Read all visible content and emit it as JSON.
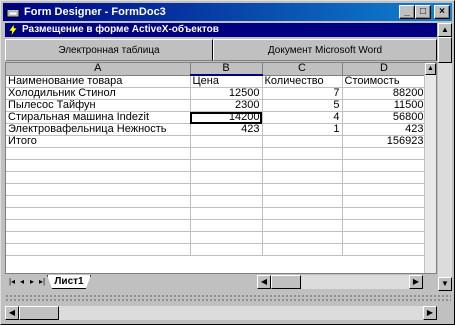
{
  "window": {
    "title": "Form Designer - FormDoc3",
    "buttons": {
      "minimize": "_",
      "maximize": "□",
      "close": "×"
    }
  },
  "subwindow": {
    "title": "Размещение в форме ActiveX-объектов"
  },
  "tabs": [
    {
      "label": "Электронная таблица"
    },
    {
      "label": "Документ Microsoft Word"
    }
  ],
  "sheet": {
    "columns": [
      "A",
      "B",
      "C",
      "D"
    ],
    "selected_column": "B",
    "rows": [
      [
        "Наименование товара",
        "Цена",
        "Количество",
        "Стоимость"
      ],
      [
        "Холодильник Стинол",
        "12500",
        "7",
        "88200"
      ],
      [
        "Пылесос Тайфун",
        "2300",
        "5",
        "11500"
      ],
      [
        "Стиральная машина Indezit",
        "14200",
        "4",
        "56800"
      ],
      [
        "Электровафельница Нежность",
        "423",
        "1",
        "423"
      ],
      [
        "Итого",
        "",
        "",
        "156923"
      ],
      [
        "",
        "",
        "",
        ""
      ],
      [
        "",
        "",
        "",
        ""
      ],
      [
        "",
        "",
        "",
        ""
      ],
      [
        "",
        "",
        "",
        ""
      ],
      [
        "",
        "",
        "",
        ""
      ],
      [
        "",
        "",
        "",
        ""
      ],
      [
        "",
        "",
        "",
        ""
      ],
      [
        "",
        "",
        "",
        ""
      ],
      [
        "",
        "",
        "",
        ""
      ]
    ],
    "active_cell": {
      "row": 3,
      "col": 1
    },
    "sheet_tab": "Лист1"
  },
  "icons": {
    "app": "form-designer-icon",
    "sub": "lightning-icon"
  }
}
